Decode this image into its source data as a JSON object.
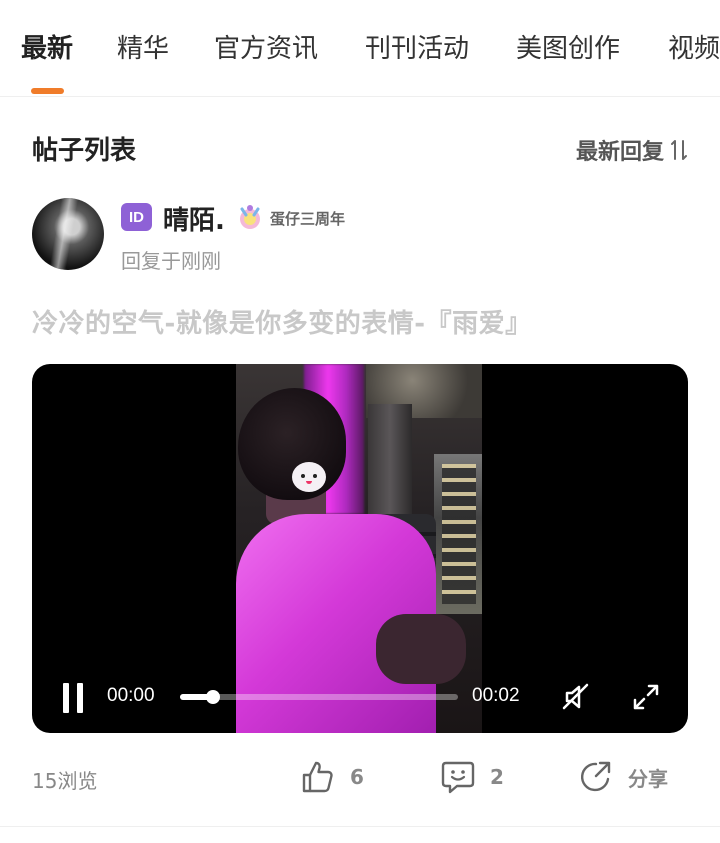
{
  "tabs": [
    {
      "label": "最新",
      "active": true
    },
    {
      "label": "精华",
      "active": false
    },
    {
      "label": "官方资讯",
      "active": false
    },
    {
      "label": "刊刊活动",
      "active": false
    },
    {
      "label": "美图创作",
      "active": false
    },
    {
      "label": "视频",
      "active": false
    }
  ],
  "colors": {
    "accent": "#f07c2a",
    "id_badge": "#8e61d6",
    "title_gray": "#c8c8c8"
  },
  "section": {
    "title": "帖子列表",
    "sort_label": "最新回复",
    "sort_icon": "sort-arrows-icon"
  },
  "post": {
    "author": {
      "badge": "ID",
      "name": "晴陌.",
      "medal_icon": "anniversary-medal-icon",
      "tag": "蛋仔三周年"
    },
    "reply_time": "回复于刚刚",
    "title": "冷冷的空气-就像是你多变的表情-『雨爱』",
    "video": {
      "current_time": "00:00",
      "duration": "00:02",
      "progress": 0.12,
      "playing": true,
      "muted": true
    },
    "stats": {
      "views": "15浏览",
      "likes": "6",
      "comments": "2",
      "share_label": "分享"
    }
  }
}
